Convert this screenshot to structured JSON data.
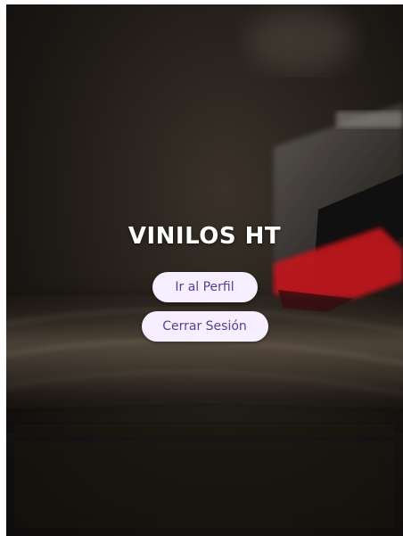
{
  "app": {
    "title": "VINILOS HT"
  },
  "actions": {
    "profile_label": "Ir al Perfil",
    "logout_label": "Cerrar Sesión"
  },
  "colors": {
    "button_bg": "#f6efff",
    "button_text": "#5b3f8e",
    "title_text": "#ffffff"
  },
  "icons": {
    "background": "vinyl-turntable-photo"
  }
}
